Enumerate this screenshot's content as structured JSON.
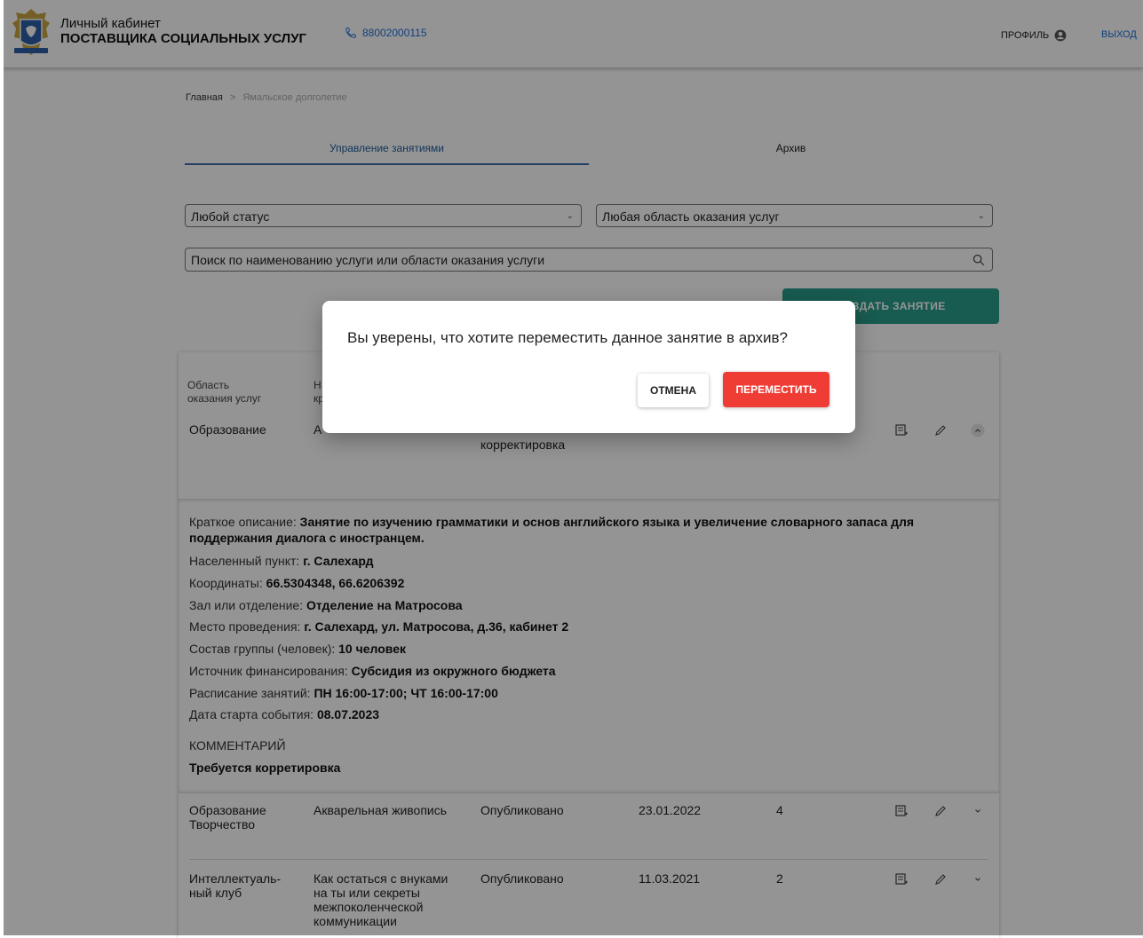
{
  "header": {
    "title_line1": "Личный кабинет",
    "title_line2": "ПОСТАВЩИКА СОЦИАЛЬНЫХ УСЛУГ",
    "phone": "88002000115",
    "profile_label": "ПРОФИЛЬ",
    "logout_label": "ВЫХОД"
  },
  "breadcrumb": {
    "home": "Главная",
    "separator": ">",
    "current": "Ямальское долголетие"
  },
  "tabs": [
    {
      "label": "Управление занятиями"
    },
    {
      "label": "Архив"
    }
  ],
  "filters": {
    "status": "Любой статус",
    "area": "Любая область оказания услуг",
    "search_placeholder": "Поиск по наименованию услуги или области оказания услуги"
  },
  "create_button": "СОЗДАТЬ ЗАНЯТИЕ",
  "table": {
    "header_area_1": "Область",
    "header_area_2": "оказания услуг",
    "header_name_1": "Н",
    "header_name_2": "кр",
    "rows": [
      {
        "area": "Образование",
        "name": "А",
        "status": "корректировка"
      },
      {
        "area_1": "Образование",
        "area_2": "Творчество",
        "name": "Акварельная живопись",
        "status": "Опубликовано",
        "date": "23.01.2022",
        "count": "4"
      },
      {
        "area_1": "Интеллектуаль-",
        "area_2": "ный клуб",
        "name_1": "Как остаться с внуками",
        "name_2": "на ты или секреты",
        "name_3": "межпоколенческой",
        "name_4": "коммуникации",
        "status": "Опубликовано",
        "date": "11.03.2021",
        "count": "2"
      }
    ]
  },
  "details": {
    "desc_label": "Краткое описание:",
    "desc_1": "Занятие по изучению грамматики и основ английского языка и увеличение словарного запаса для",
    "desc_2": "поддержания диалога с иностранцем.",
    "city_label": "Населенный пункт:",
    "city": "г. Салехард",
    "coords_label": "Координаты:",
    "coords": "66.5304348, 66.6206392",
    "hall_label": "Зал или отделение:",
    "hall": "Отделение на Матросова",
    "place_label": "Место проведения:",
    "place": "г. Салехард, ул. Матросова, д.36, кабинет 2",
    "group_label": "Состав группы (человек):",
    "group": "10 человек",
    "funding_label": "Источник финансирования:",
    "funding": "Субсидия из окружного бюджета",
    "schedule_label": "Расписание занятий:",
    "schedule": "ПН 16:00-17:00; ЧТ 16:00-17:00",
    "start_label": "Дата старта события:",
    "start": "08.07.2023",
    "comment_label": "КОММЕНТАРИЙ",
    "comment": "Требуется корретировка"
  },
  "dialog": {
    "text": "Вы уверены, что хотите переместить данное занятие в архив?",
    "cancel": "ОТМЕНА",
    "confirm": "ПЕРЕМЕСТИТЬ"
  },
  "colors": {
    "primary": "#2a9d8a",
    "danger": "#ef3d35",
    "link": "#1e6fd9"
  },
  "icons": [
    "phone-icon",
    "account-circle-icon",
    "archive-icon",
    "pencil-icon",
    "chevron-up-icon",
    "chevron-down-icon",
    "search-icon",
    "coat-of-arms-logo"
  ]
}
